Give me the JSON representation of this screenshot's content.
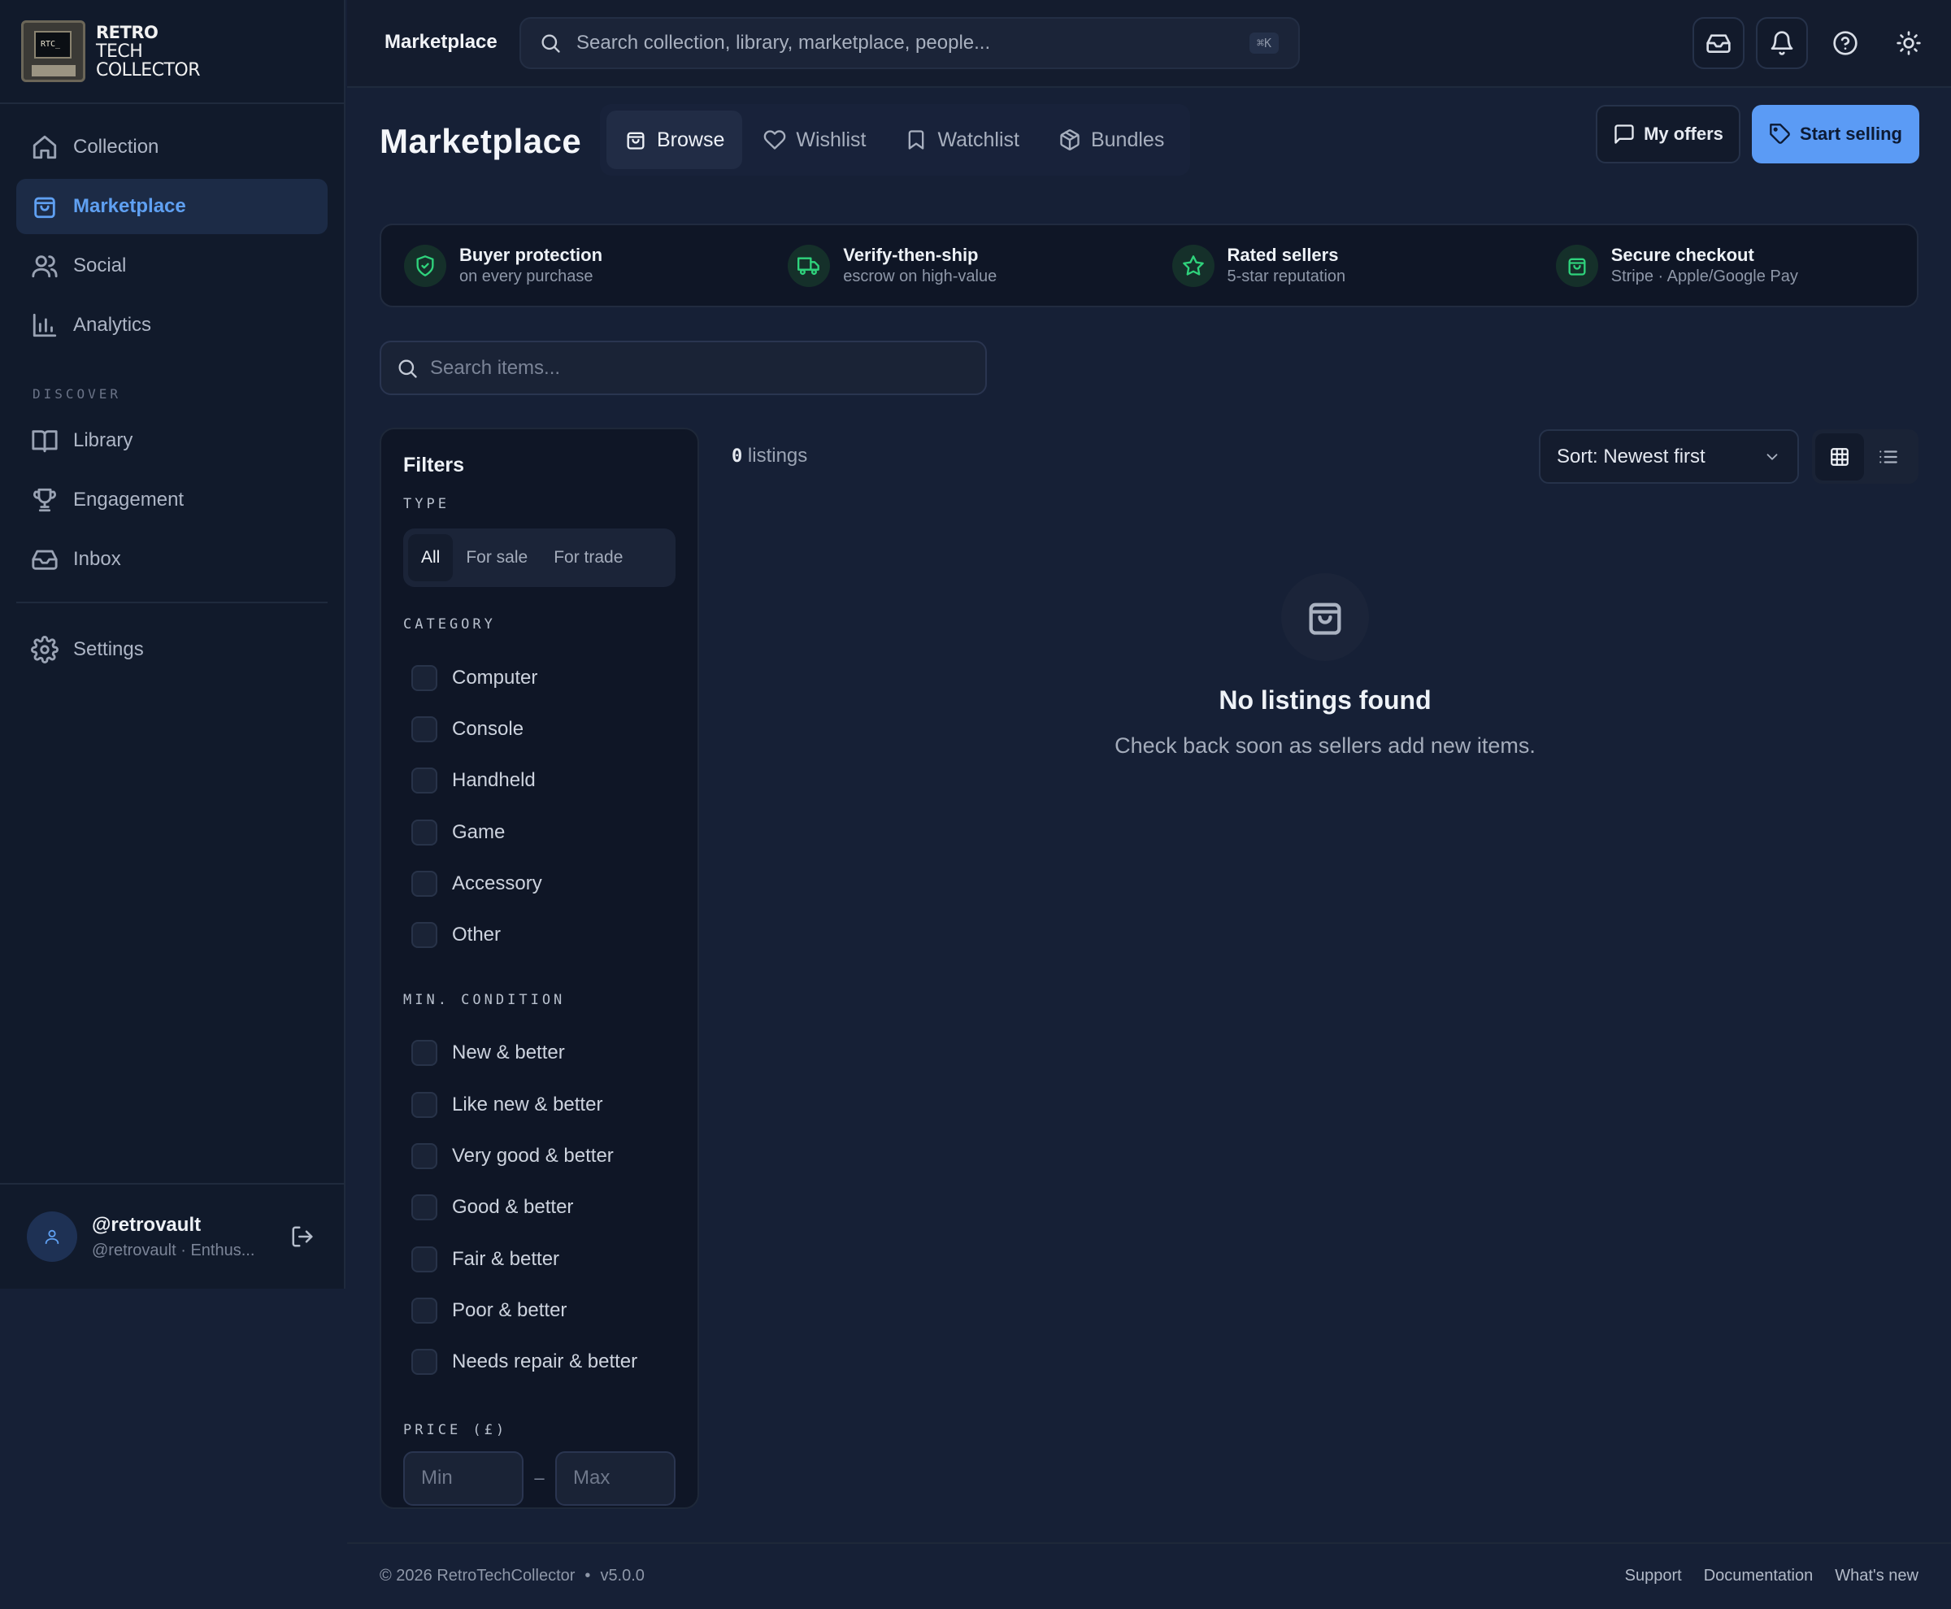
{
  "brand": {
    "line1": "RETRO",
    "line2": "TECH",
    "line3": "COLLECTOR",
    "screen_text": "RTC_"
  },
  "sidebar": {
    "items": [
      {
        "label": "Collection",
        "icon": "home-icon"
      },
      {
        "label": "Marketplace",
        "icon": "shopping-bag-icon",
        "active": true
      },
      {
        "label": "Social",
        "icon": "users-icon"
      },
      {
        "label": "Analytics",
        "icon": "bar-chart-icon"
      }
    ],
    "section_label": "DISCOVER",
    "discover_items": [
      {
        "label": "Library",
        "icon": "book-icon"
      },
      {
        "label": "Engagement",
        "icon": "trophy-icon"
      },
      {
        "label": "Inbox",
        "icon": "inbox-icon"
      }
    ],
    "settings_label": "Settings"
  },
  "user": {
    "name": "@retrovault",
    "subtitle": "@retrovault · Enthus..."
  },
  "topbar": {
    "title": "Marketplace",
    "search_placeholder": "Search collection, library, marketplace, people...",
    "shortcut": "⌘K"
  },
  "page": {
    "title": "Marketplace",
    "tabs": [
      {
        "label": "Browse",
        "icon": "shopping-bag-icon",
        "active": true
      },
      {
        "label": "Wishlist",
        "icon": "heart-icon"
      },
      {
        "label": "Watchlist",
        "icon": "bookmark-icon"
      },
      {
        "label": "Bundles",
        "icon": "package-icon"
      }
    ],
    "my_offers_label": "My offers",
    "start_selling_label": "Start selling"
  },
  "trust": [
    {
      "title": "Buyer protection",
      "subtitle": "on every purchase",
      "icon": "shield-check-icon"
    },
    {
      "title": "Verify-then-ship",
      "subtitle": "escrow on high-value",
      "icon": "truck-icon"
    },
    {
      "title": "Rated sellers",
      "subtitle": "5-star reputation",
      "icon": "star-icon"
    },
    {
      "title": "Secure checkout",
      "subtitle": "Stripe · Apple/Google Pay",
      "icon": "shopping-bag-icon"
    }
  ],
  "item_search": {
    "placeholder": "Search items..."
  },
  "filters": {
    "title": "Filters",
    "type_label": "TYPE",
    "type_options": [
      "All",
      "For sale",
      "For trade"
    ],
    "type_selected": "All",
    "category_label": "CATEGORY",
    "categories": [
      "Computer",
      "Console",
      "Handheld",
      "Game",
      "Accessory",
      "Other"
    ],
    "condition_label": "MIN. CONDITION",
    "conditions": [
      "New & better",
      "Like new & better",
      "Very good & better",
      "Good & better",
      "Fair & better",
      "Poor & better",
      "Needs repair & better"
    ],
    "price_label": "PRICE (£)",
    "price_min_placeholder": "Min",
    "price_max_placeholder": "Max",
    "price_separator": "–"
  },
  "results": {
    "count": "0",
    "count_suffix": "listings",
    "sort_label": "Sort: Newest first",
    "view_mode": "grid"
  },
  "empty": {
    "title": "No listings found",
    "subtitle": "Check back soon as sellers add new items."
  },
  "footer": {
    "copyright": "© 2026 RetroTechCollector",
    "bullet": "•",
    "version": "v5.0.0",
    "links": [
      "Support",
      "Documentation",
      "What's new"
    ]
  },
  "colors": {
    "accent": "#5b9bf5",
    "success": "#2fd37c",
    "background": "#162036"
  }
}
